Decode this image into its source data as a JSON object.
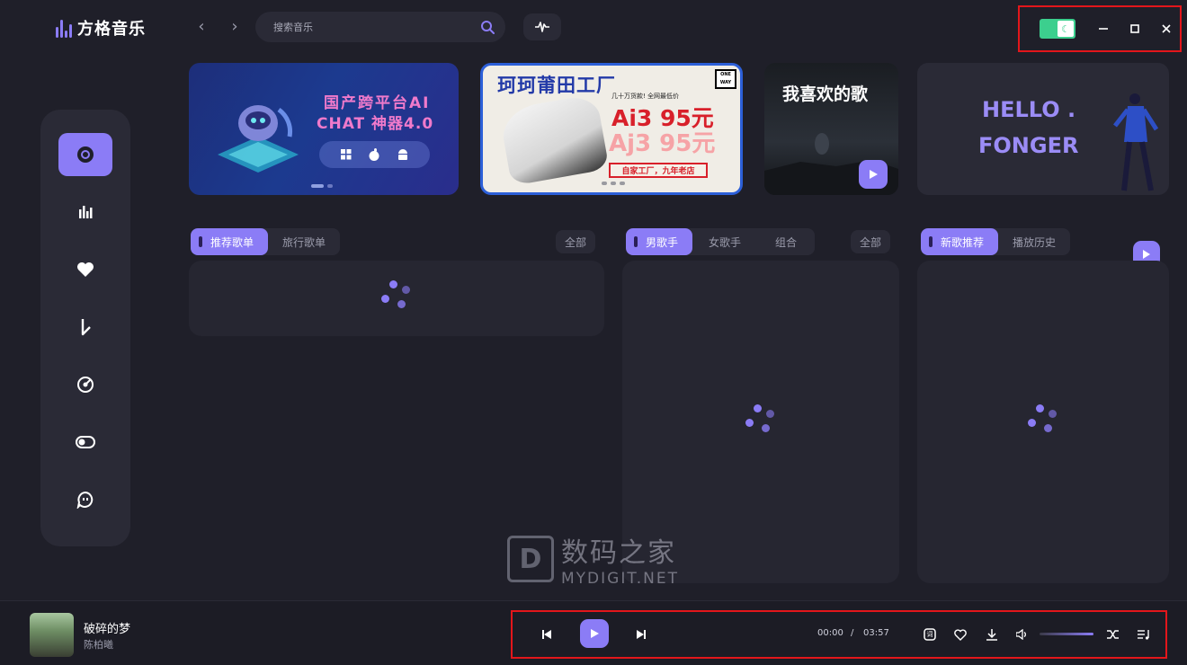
{
  "app": {
    "title": "方格音乐",
    "search_placeholder": "搜索音乐"
  },
  "banners": {
    "b1": {
      "line1": "国产跨平台AI",
      "line2": "CHAT 神器4.0"
    },
    "b2": {
      "title": "珂珂莆田工厂",
      "price1": "Ai3 95元",
      "price2": "Aj3 95元",
      "sub": "几十万货款! 全网最低价",
      "strip": "自家工厂，九年老店",
      "tag": "ONE WAY"
    },
    "b3": {
      "title": "我喜欢的歌"
    },
    "b4": {
      "line1": "HELLO .",
      "line2": "FONGER"
    }
  },
  "panels": {
    "left": {
      "tabs": [
        "推荐歌单",
        "旅行歌单"
      ],
      "all": "全部"
    },
    "middle": {
      "tabs": [
        "男歌手",
        "女歌手",
        "组合"
      ],
      "all": "全部"
    },
    "right": {
      "tabs": [
        "新歌推荐",
        "播放历史"
      ]
    }
  },
  "watermark": {
    "cn": "数码之家",
    "en": "MYDIGIT.NET",
    "box": "D"
  },
  "player": {
    "song": "破碎的梦",
    "artist": "陈柏曦",
    "current": "00:00",
    "sep": "/",
    "duration": "03:57",
    "lyrics_icon_label": "词"
  },
  "colors": {
    "accent": "#8b7cf6",
    "toggle": "#3ccf8e",
    "highlight_border": "#e3161b"
  }
}
